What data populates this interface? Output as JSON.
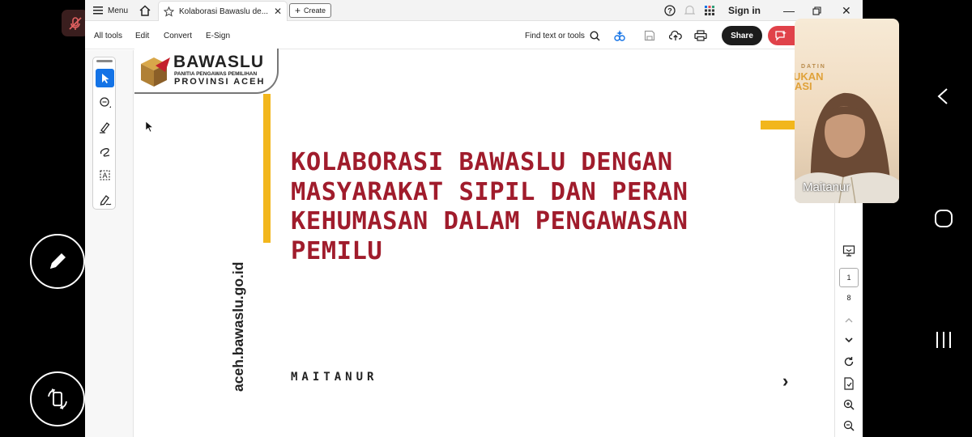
{
  "tabbar": {
    "menu_label": "Menu",
    "tab_title": "Kolaborasi Bawaslu de...",
    "create_label": "Create",
    "sign_in_label": "Sign in"
  },
  "toolbar": {
    "all_tools": "All tools",
    "edit": "Edit",
    "convert": "Convert",
    "esign": "E-Sign",
    "find_placeholder": "Find text or tools",
    "share_label": "Share"
  },
  "document": {
    "logo_name": "BAWASLU",
    "logo_sub": "PANITIA PENGAWAS PEMILIHAN",
    "logo_region": "PROVINSI ACEH",
    "title_lines": [
      "KOLABORASI BAWASLU DENGAN",
      "MASYARAKAT SIPIL DAN PERAN",
      "KEHUMASAN DALAM PENGAWASAN",
      "PEMILU"
    ],
    "author": "MAITANUR",
    "website": "aceh.bawaslu.go.id",
    "next_glyph": "›"
  },
  "pager": {
    "current_page": "1",
    "total_pages": "8"
  },
  "video": {
    "participant_name": "Maitanur",
    "bg_text_1": "DATIN",
    "bg_text_2": "UKAN",
    "bg_text_3": "ASI"
  },
  "colors": {
    "title_red": "#a01c2c",
    "accent_yellow": "#f2b61c",
    "share_bg": "#1c1c1c",
    "active_tool": "#1473e6"
  }
}
